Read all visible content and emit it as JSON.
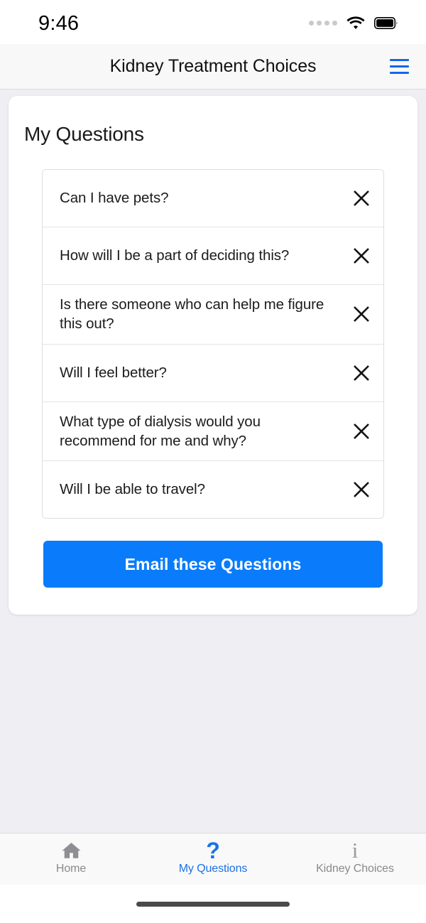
{
  "status_bar": {
    "time": "9:46",
    "signal_icon": "signal-dots-icon",
    "wifi_icon": "wifi-icon",
    "battery_icon": "battery-full-icon"
  },
  "header": {
    "title": "Kidney Treatment Choices",
    "menu_icon": "hamburger-menu-icon"
  },
  "main": {
    "section_title": "My Questions",
    "questions": [
      {
        "text": "Can I have pets?",
        "remove_icon": "close-x-icon"
      },
      {
        "text": "How will I be a part of deciding this?",
        "remove_icon": "close-x-icon"
      },
      {
        "text": "Is there someone who can help me figure this out?",
        "remove_icon": "close-x-icon"
      },
      {
        "text": "Will I feel better?",
        "remove_icon": "close-x-icon"
      },
      {
        "text": "What type of dialysis would you recommend for me and why?",
        "remove_icon": "close-x-icon"
      },
      {
        "text": "Will I be able to travel?",
        "remove_icon": "close-x-icon"
      }
    ],
    "email_button_label": "Email these Questions"
  },
  "tab_bar": {
    "tabs": [
      {
        "label": "Home",
        "icon": "home-icon",
        "active": false
      },
      {
        "label": "My Questions",
        "icon": "question-mark-icon",
        "active": true
      },
      {
        "label": "Kidney Choices",
        "icon": "info-icon",
        "active": false
      }
    ]
  },
  "colors": {
    "accent_blue": "#0A7CFB",
    "tab_active_blue": "#1C72E8",
    "menu_blue": "#1766E8",
    "page_background": "#EFEEF3",
    "card_background": "#FFFFFF",
    "tab_inactive_gray": "#8A8A8E"
  }
}
